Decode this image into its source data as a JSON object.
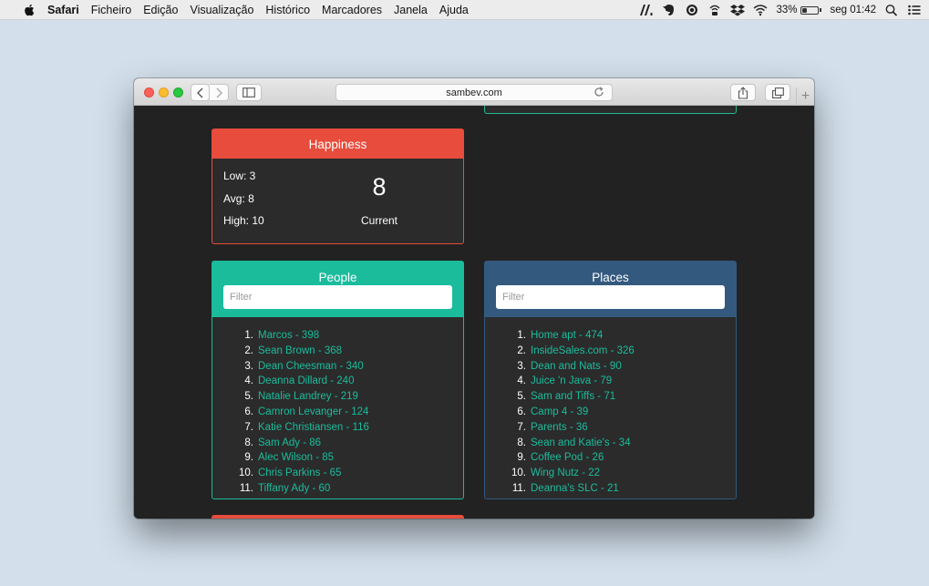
{
  "menubar": {
    "app_name": "Safari",
    "menus": [
      "Ficheiro",
      "Edição",
      "Visualização",
      "Histórico",
      "Marcadores",
      "Janela",
      "Ajuda"
    ],
    "battery_percent": "33%",
    "battery_level": 0.33,
    "clock": "seg 01:42"
  },
  "browser": {
    "url": "sambev.com"
  },
  "happiness": {
    "title": "Happiness",
    "low": "Low: 3",
    "avg": "Avg: 8",
    "high": "High: 10",
    "current_value": "8",
    "current_label": "Current"
  },
  "people": {
    "title": "People",
    "filter_placeholder": "Filter",
    "items": [
      {
        "rank": "1.",
        "text": "Marcos - 398"
      },
      {
        "rank": "2.",
        "text": "Sean Brown - 368"
      },
      {
        "rank": "3.",
        "text": "Dean Cheesman - 340"
      },
      {
        "rank": "4.",
        "text": "Deanna Dillard - 240"
      },
      {
        "rank": "5.",
        "text": "Natalie Landrey - 219"
      },
      {
        "rank": "6.",
        "text": "Camron Levanger - 124"
      },
      {
        "rank": "7.",
        "text": "Katie Christiansen - 116"
      },
      {
        "rank": "8.",
        "text": "Sam Ady - 86"
      },
      {
        "rank": "9.",
        "text": "Alec Wilson - 85"
      },
      {
        "rank": "10.",
        "text": "Chris Parkins - 65"
      },
      {
        "rank": "11.",
        "text": "Tiffany Ady - 60"
      }
    ]
  },
  "places": {
    "title": "Places",
    "filter_placeholder": "Filter",
    "items": [
      {
        "rank": "1.",
        "text": "Home apt - 474"
      },
      {
        "rank": "2.",
        "text": "InsideSales.com - 326"
      },
      {
        "rank": "3.",
        "text": "Dean and Nats - 90"
      },
      {
        "rank": "4.",
        "text": "Juice 'n Java - 79"
      },
      {
        "rank": "5.",
        "text": "Sam and Tiffs - 71"
      },
      {
        "rank": "6.",
        "text": "Camp 4 - 39"
      },
      {
        "rank": "7.",
        "text": "Parents - 36"
      },
      {
        "rank": "8.",
        "text": "Sean and Katie's - 34"
      },
      {
        "rank": "9.",
        "text": "Coffee Pod - 26"
      },
      {
        "rank": "10.",
        "text": "Wing Nutz - 22"
      },
      {
        "rank": "11.",
        "text": "Deanna's SLC - 21"
      }
    ]
  },
  "colors": {
    "people_accent": "#1abc9c",
    "places_accent": "#34597e",
    "happiness_accent": "#e74c3c",
    "page_bg": "#222222"
  },
  "icons": {
    "menubar_right": [
      "adobe-icon",
      "evernote-icon",
      "sync-icon",
      "airport-icon",
      "dropbox-icon",
      "wifi-icon",
      "battery-icon",
      "spotlight-icon",
      "notification-center-icon"
    ]
  }
}
